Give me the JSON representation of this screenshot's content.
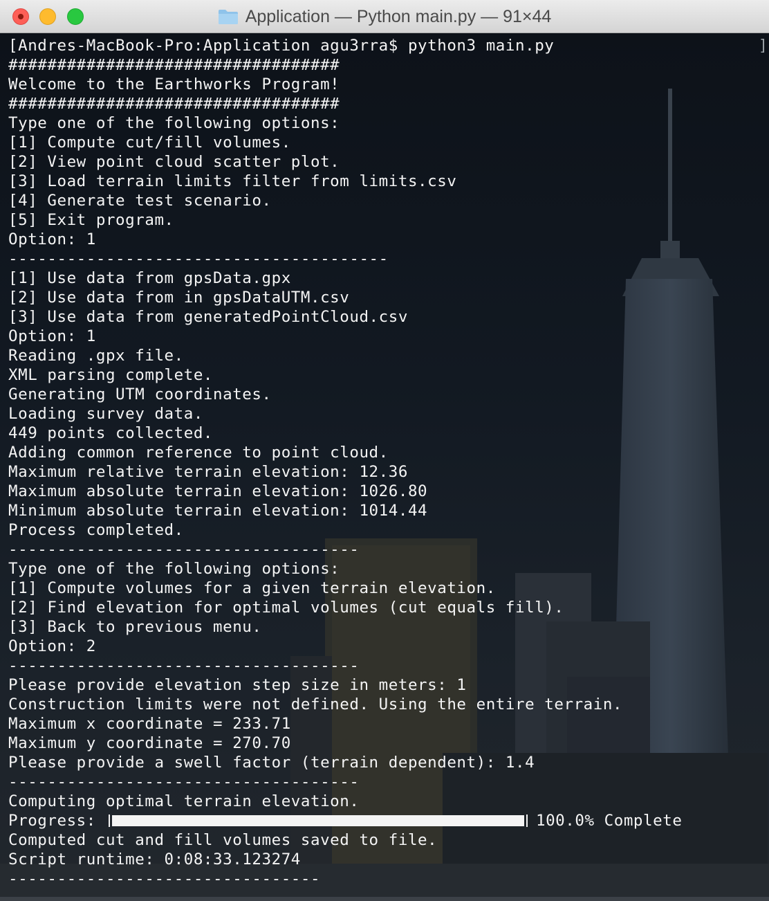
{
  "window": {
    "title": "Application — Python main.py — 91×44",
    "title_icon": "folder-icon"
  },
  "terminal": {
    "lines": [
      "[Andres-MacBook-Pro:Application agu3rra$ python3 main.py",
      "##################################",
      "Welcome to the Earthworks Program!",
      "##################################",
      "Type one of the following options:",
      "[1] Compute cut/fill volumes.",
      "[2] View point cloud scatter plot.",
      "[3] Load terrain limits filter from limits.csv",
      "[4] Generate test scenario.",
      "[5] Exit program.",
      "Option: 1",
      "---------------------------------------",
      "[1] Use data from gpsData.gpx",
      "[2] Use data from in gpsDataUTM.csv",
      "[3] Use data from generatedPointCloud.csv",
      "Option: 1",
      "Reading .gpx file.",
      "XML parsing complete.",
      "Generating UTM coordinates.",
      "Loading survey data.",
      "449 points collected.",
      "Adding common reference to point cloud.",
      "Maximum relative terrain elevation: 12.36",
      "Maximum absolute terrain elevation: 1026.80",
      "Minimum absolute terrain elevation: 1014.44",
      "Process completed.",
      "------------------------------------",
      "Type one of the following options:",
      "[1] Compute volumes for a given terrain elevation.",
      "[2] Find elevation for optimal volumes (cut equals fill).",
      "[3] Back to previous menu.",
      "Option: 2",
      "------------------------------------",
      "Please provide elevation step size in meters: 1",
      "Construction limits were not defined. Using the entire terrain.",
      "Maximum x coordinate = 233.71",
      "Maximum y coordinate = 270.70",
      "Please provide a swell factor (terrain dependent): 1.4",
      "------------------------------------",
      "Computing optimal terrain elevation."
    ],
    "progress": {
      "label": "Progress: ",
      "percent": 100.0,
      "percent_text": "100.0% Complete"
    },
    "after_lines": [
      "Computed cut and fill volumes saved to file.",
      "Script runtime: 0:08:33.123274",
      "--------------------------------"
    ],
    "right_bracket": "]"
  },
  "colors": {
    "text": "#f4f4f4",
    "close": "#fd5f57",
    "minimize": "#febb2e",
    "zoom": "#29c840"
  }
}
